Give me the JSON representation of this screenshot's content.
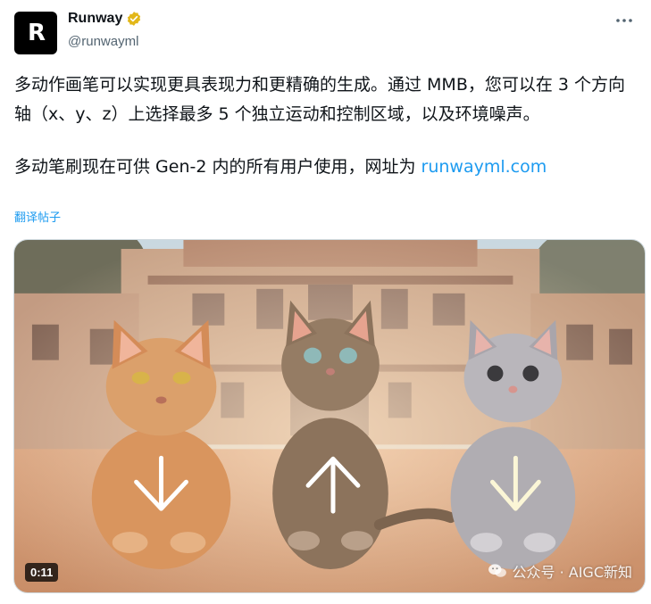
{
  "author": {
    "display_name": "Runway",
    "handle": "@runwayml",
    "avatar_glyph": "R"
  },
  "tweet": {
    "paragraph1": "多动作画笔可以实现更具表现力和更精确的生成。通过 MMB，您可以在 3 个方向轴（x、y、z）上选择最多 5 个独立运动和控制区域，以及环境噪声。",
    "paragraph2_prefix": "多动笔刷现在可供 Gen-2 内的所有用户使用，网址为 ",
    "paragraph2_link": "runwayml.com",
    "translate_label": "翻译帖子"
  },
  "media": {
    "duration": "0:11",
    "watermark": "公众号 · AIGC新知"
  },
  "colors": {
    "link": "#1d9bf0",
    "muted": "#536471",
    "verified": "#e2b719"
  },
  "icons": {
    "more": "more-dots-icon",
    "verified": "verified-badge-icon"
  }
}
